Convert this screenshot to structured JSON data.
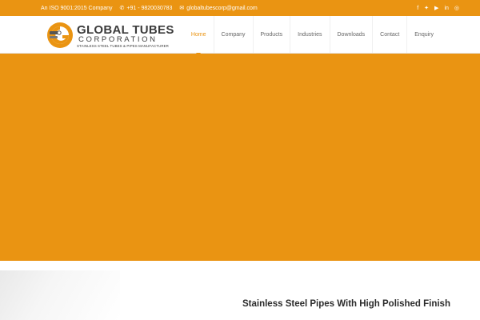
{
  "topbar": {
    "iso": "An ISO 9001:2015 Company",
    "phone": "+91 - 9820030783",
    "email": "globaltubescorp@gmail.com",
    "social": [
      {
        "icon": "facebook-icon",
        "glyph": "f"
      },
      {
        "icon": "twitter-icon",
        "glyph": "✦"
      },
      {
        "icon": "youtube-icon",
        "glyph": "▶"
      },
      {
        "icon": "linkedin-icon",
        "glyph": "in"
      },
      {
        "icon": "instagram-icon",
        "glyph": "◎"
      }
    ]
  },
  "logo": {
    "title": "GLOBAL TUBES",
    "subtitle": "CORPORATION",
    "tagline": "STAINLESS STEEL TUBES & PIPES MANUFACTURER"
  },
  "nav": {
    "items": [
      "Home",
      "Company",
      "Products",
      "Industries",
      "Downloads",
      "Contact",
      "Enquiry"
    ],
    "active_index": 0
  },
  "section": {
    "title": "Stainless Steel Pipes With High Polished Finish"
  },
  "colors": {
    "accent": "#ea9412",
    "text_dark": "#3b3b3b"
  }
}
